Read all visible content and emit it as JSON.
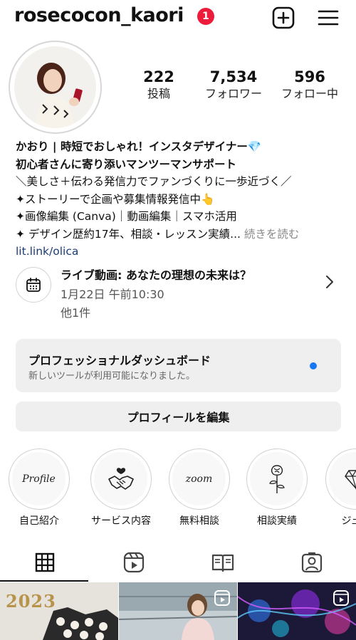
{
  "header": {
    "username": "rosecocon_kaori",
    "notification_count": "1",
    "icons": [
      "add-post-icon",
      "menu-icon"
    ]
  },
  "stats": [
    {
      "value": "222",
      "label": "投稿"
    },
    {
      "value": "7,534",
      "label": "フォロワー"
    },
    {
      "value": "596",
      "label": "フォロー中"
    }
  ],
  "bio": {
    "name_line": "かおり | 時短でおしゃれ！インスタデザイナー💎",
    "line2": "初心者さんに寄り添いマンツーマンサポート",
    "line3": "＼美しさ＋伝わる発信力でファンづくりに一歩近づく／",
    "line4": "✦ストーリーで企画や募集情報発信中👆",
    "line5": "✦画像編集 (Canva)｜動画編集｜スマホ活用",
    "line6": "✦ デザイン歴約17年、相談・レッスン実績...",
    "more": "続きを読む",
    "link": "lit.link/olica"
  },
  "event": {
    "title": "ライブ動画: あなたの理想の未来は？",
    "date": "1月22日 午前10:30",
    "more": "他1件"
  },
  "dashboard": {
    "title": "プロフェッショナルダッシュボード",
    "subtitle": "新しいツールが利用可能になりました。"
  },
  "edit_profile_label": "プロフィールを編集",
  "highlights": [
    {
      "cover_text": "Profile",
      "label": "自己紹介"
    },
    {
      "cover_text": "",
      "label": "サービス内容"
    },
    {
      "cover_text": "zoom",
      "label": "無料相談"
    },
    {
      "cover_text": "",
      "label": "相談実績"
    },
    {
      "cover_text": "",
      "label": "ジュエ"
    }
  ],
  "tabs": [
    "grid-tab",
    "reels-tab",
    "guides-tab",
    "tagged-tab"
  ],
  "grid": [
    {
      "text": "2023"
    },
    {
      "text": ""
    },
    {
      "text": ""
    }
  ],
  "colors": {
    "badge": "#ed1c3a",
    "link": "#1a3c7a",
    "accent_dot": "#1877f2",
    "button_bg": "#efefef"
  }
}
